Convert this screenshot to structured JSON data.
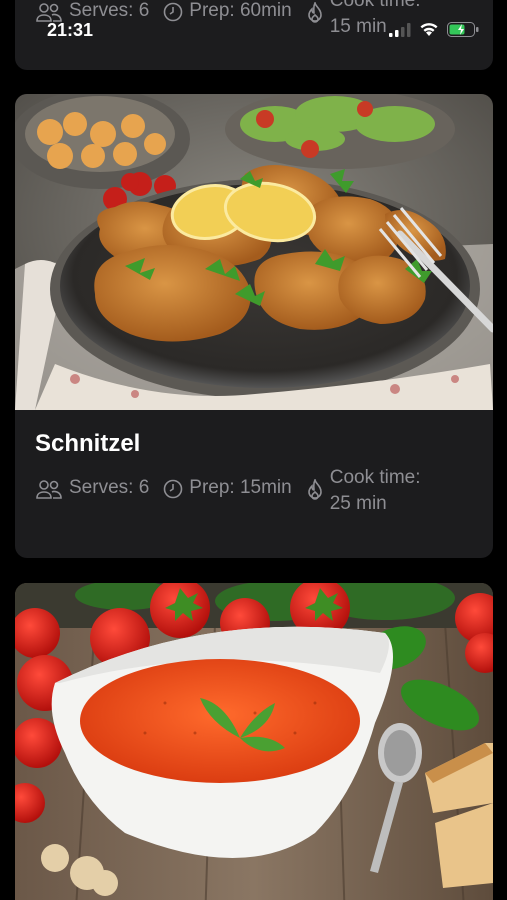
{
  "status_bar": {
    "time": "21:31"
  },
  "recipes": [
    {
      "title": "",
      "serves": "Serves: 6",
      "prep": "Prep: 60min",
      "cook_line1": "Cook time:",
      "cook_line2": "15 min"
    },
    {
      "title": "Schnitzel",
      "serves": "Serves: 6",
      "prep": "Prep: 15min",
      "cook_line1": "Cook time:",
      "cook_line2": "25 min"
    }
  ],
  "colors": {
    "background": "#000000",
    "card": "#1c1c1e",
    "meta_text": "#8e8e93",
    "battery": "#34c759"
  },
  "icons": [
    "people-icon",
    "clock-icon",
    "flame-icon",
    "signal-icon",
    "wifi-icon",
    "battery-icon"
  ]
}
